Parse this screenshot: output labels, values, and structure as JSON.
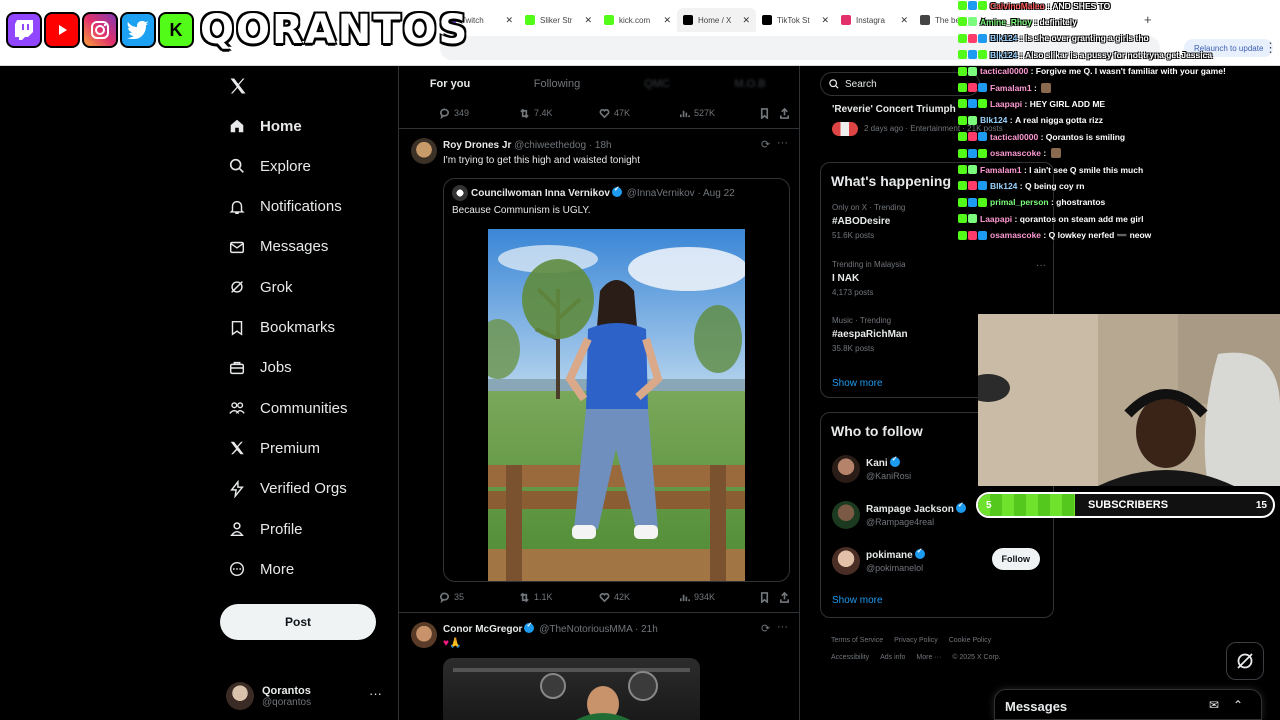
{
  "browser": {
    "tabs": [
      {
        "title": "Twitch",
        "color": "#9146ff",
        "active": false
      },
      {
        "title": "Sliker Str",
        "color": "#53fc18",
        "active": false
      },
      {
        "title": "kick.com",
        "color": "#53fc18",
        "active": false
      },
      {
        "title": "Home / X",
        "color": "#000000",
        "active": true
      },
      {
        "title": "TikTok St",
        "color": "#000000",
        "active": false
      },
      {
        "title": "Instagra",
        "color": "#e1306c",
        "active": false
      },
      {
        "title": "The bes",
        "color": "#444444",
        "active": false
      }
    ],
    "reload_to_update": "Relaunch to update"
  },
  "overlay": {
    "streamer_name": "QORANTOS",
    "kick_letter": "K",
    "subscribers_label": "SUBSCRIBERS",
    "subscribers_start": "5",
    "subscribers_goal": "15",
    "subscribers_progress": 0.33
  },
  "nav": {
    "items": [
      {
        "label": "Home",
        "icon": "home-icon",
        "active": true
      },
      {
        "label": "Explore",
        "icon": "search-icon"
      },
      {
        "label": "Notifications",
        "icon": "bell-icon"
      },
      {
        "label": "Messages",
        "icon": "mail-icon"
      },
      {
        "label": "Grok",
        "icon": "grok-icon"
      },
      {
        "label": "Bookmarks",
        "icon": "bookmark-icon"
      },
      {
        "label": "Jobs",
        "icon": "briefcase-icon"
      },
      {
        "label": "Communities",
        "icon": "people-icon"
      },
      {
        "label": "Premium",
        "icon": "x-icon"
      },
      {
        "label": "Verified Orgs",
        "icon": "lightning-icon"
      },
      {
        "label": "Profile",
        "icon": "person-icon"
      },
      {
        "label": "More",
        "icon": "more-circle-icon"
      }
    ],
    "post_label": "Post",
    "account": {
      "name": "Qorantos",
      "handle": "@qorantos"
    }
  },
  "timeline": {
    "tabs": {
      "for_you": "For you",
      "following": "Following",
      "t3": "QMC",
      "t4": "M.O.B"
    },
    "prev_actions": {
      "replies": "349",
      "reposts": "7.4K",
      "likes": "47K",
      "views": "527K"
    },
    "tweet1": {
      "name": "Roy Drones Jr",
      "handle": "@chiweethedog",
      "time": "· 18h",
      "text": "I'm trying to get this high and waisted tonight",
      "quote": {
        "name": "Councilwoman Inna Vernikov",
        "handle": "@InnaVernikov",
        "time": "· Aug 22",
        "text": "Because Communism is UGLY."
      },
      "actions": {
        "replies": "35",
        "reposts": "1.1K",
        "likes": "42K",
        "views": "934K"
      }
    },
    "tweet2": {
      "name": "Conor McGregor",
      "handle": "@TheNotoriousMMA",
      "time": "· 21h",
      "text": "♥🙏"
    }
  },
  "right": {
    "search_placeholder": "Search",
    "concert": {
      "title": "'Reverie' Concert Triumph",
      "meta": "2 days ago · Entertainment · 21K posts"
    },
    "whats_happening": "What's happening",
    "trends": [
      {
        "meta": "Only on X · Trending",
        "title": "#ABODesire",
        "count": "51.6K posts"
      },
      {
        "meta": "Trending in Malaysia",
        "title": "I NAK",
        "count": "4,173 posts"
      },
      {
        "meta": "Music · Trending",
        "title": "#aespaRichMan",
        "count": "35.8K posts"
      }
    ],
    "show_more": "Show more",
    "who_to_follow": "Who to follow",
    "suggestions": [
      {
        "name": "Kani",
        "handle": "@KaniRosi"
      },
      {
        "name": "Rampage Jackson",
        "handle": "@Rampage4real"
      },
      {
        "name": "pokimane",
        "handle": "@pokimanelol"
      }
    ],
    "follow_label": "Follow",
    "footer": [
      "Terms of Service",
      "Privacy Policy",
      "Cookie Policy",
      "Accessibility",
      "Ads info",
      "More ···",
      "© 2025 X Corp."
    ]
  },
  "chat": [
    {
      "user": "CalvinoMaleo",
      "color": "#ff5a5a",
      "msg": "AND SHES TO"
    },
    {
      "user": "Amine_Rhoy",
      "color": "#7cfc7c",
      "msg": "definitely"
    },
    {
      "user": "Blk124",
      "color": "#9ad3ff",
      "msg": "Is she over granting a girls tho"
    },
    {
      "user": "Blk124",
      "color": "#9ad3ff",
      "msg": "Also slikar is a pussy for not tryna get Jessica"
    },
    {
      "user": "tactical0000",
      "color": "#ff9ad3",
      "msg": "Forgive me Q. I wasn't familiar with your game!"
    },
    {
      "user": "Famalam1",
      "color": "#ff9ad3",
      "msg": ""
    },
    {
      "user": "Laapapi",
      "color": "#ff9ad3",
      "msg": "HEY GIRL ADD ME"
    },
    {
      "user": "Blk124",
      "color": "#9ad3ff",
      "msg": "A real nigga gotta rizz"
    },
    {
      "user": "tactical0000",
      "color": "#ff9ad3",
      "msg": "Qorantos is smiling"
    },
    {
      "user": "osamascoke",
      "color": "#ff9ad3",
      "msg": ""
    },
    {
      "user": "Famalam1",
      "color": "#ff9ad3",
      "msg": "I ain't see Q smile this much"
    },
    {
      "user": "Blk124",
      "color": "#9ad3ff",
      "msg": "Q being coy rn"
    },
    {
      "user": "primal_person",
      "color": "#7cfc7c",
      "msg": "ghostrantos"
    },
    {
      "user": "Laapapi",
      "color": "#ff9ad3",
      "msg": "qorantos on steam add me girl"
    },
    {
      "user": "osamascoke",
      "color": "#ff9ad3",
      "msg": "Q lowkey nerfed ➖ neow"
    }
  ],
  "messages_dock": {
    "title": "Messages"
  }
}
